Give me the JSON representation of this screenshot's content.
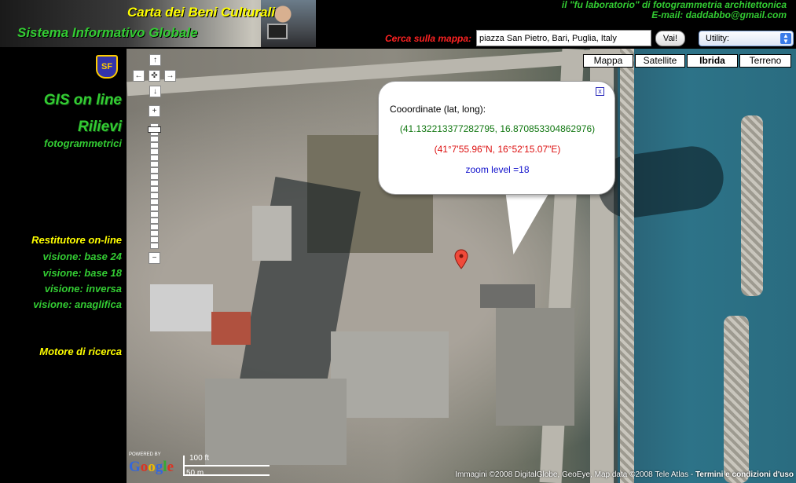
{
  "header": {
    "banner_title_1": "Carta dei Beni Culturali",
    "banner_title_2": "Sistema Informativo Globale",
    "lab_line": "il \"fu laboratorio\" di fotogrammetria architettonica",
    "email_line": "E-mail: daddabbo@gmail.com",
    "search_label": "Cerca sulla mappa:",
    "search_value": "piazza San Pietro, Bari, Puglia, Italy",
    "go_button": "Vai!",
    "utility_selected": "Utility:"
  },
  "sidebar": {
    "logo_text": "SF",
    "gis": "GIS on line",
    "rilievi": "Rilievi",
    "fotogrammetrici": "fotogrammetrici",
    "restitutore": "Restitutore on-line",
    "items": [
      "visione: base 24",
      "visione: base 18",
      "visione: inversa",
      "visione: anaglifica"
    ],
    "motore": "Motore di ricerca"
  },
  "map": {
    "types": [
      "Mappa",
      "Satellite",
      "Ibrida",
      "Terreno"
    ],
    "active_type": "Ibrida",
    "nav": {
      "up": "↑",
      "left": "←",
      "center": "✜",
      "right": "→",
      "down": "↓",
      "zoom_in": "+",
      "zoom_out": "−"
    },
    "zoom_level": 18,
    "info": {
      "close": "x",
      "heading": "Cooordinate (lat, long):",
      "coords": "(41.132213377282795, 16.870853304862976)",
      "dms": "(41°7'55.96\"N, 16°52'15.07\"E)",
      "zoom": "zoom level =18"
    },
    "powered": "POWERED BY",
    "google": "Google",
    "scale_ft": "100 ft",
    "scale_m": "50 m",
    "copyright": "Immagini ©2008 DigitalGlobe, GeoEye, Map data ©2008 Tele Atlas - ",
    "terms": "Termini e condizioni d'uso"
  },
  "colors": {
    "accent_green": "#33cc33",
    "accent_yellow": "#ffff00",
    "accent_red": "#ff2222"
  }
}
